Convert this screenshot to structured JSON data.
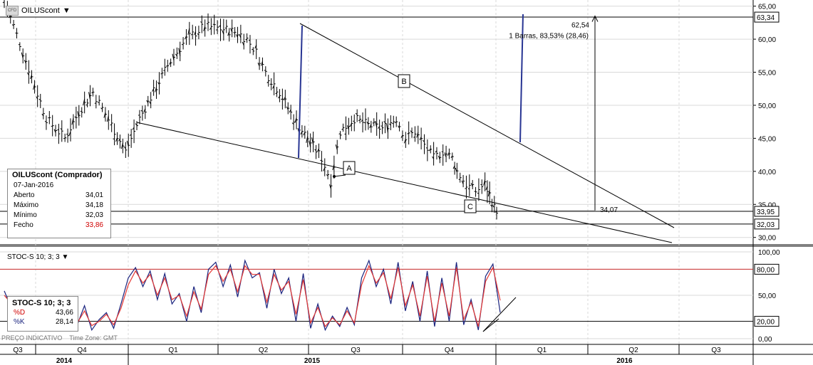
{
  "symbol": {
    "name": "OILUScont",
    "badge": "CFD"
  },
  "info_box": {
    "title": "OILUScont (Comprador)",
    "date": "07-Jan-2016",
    "rows": [
      {
        "label": "Aberto",
        "value": "34,01",
        "highlight": false
      },
      {
        "label": "Máximo",
        "value": "34,18",
        "highlight": false
      },
      {
        "label": "Mínimo",
        "value": "32,03",
        "highlight": false
      },
      {
        "label": "Fecho",
        "value": "33,86",
        "highlight": true
      }
    ]
  },
  "indicator": {
    "label": "STOC-S 10; 3; 3",
    "box_title": "STOC-S 10; 3; 3",
    "d_label": "%D",
    "d_value": "43,66",
    "k_label": "%K",
    "k_value": "28,14"
  },
  "footer": {
    "price_note": "PREÇO INDICATIVO",
    "timezone": "Time Zone: GMT"
  },
  "colors": {
    "k_line": "#1a237e",
    "d_line": "#e53935",
    "price": "#000000",
    "measure_line": "#283593",
    "hline_red": "#c62828",
    "grid": "#d9d9d9"
  },
  "chart_data": [
    {
      "type": "line",
      "subtype": "ohlc-bars",
      "title": "",
      "xlabel": "",
      "ylabel": "",
      "ylim": [
        29,
        65.5
      ],
      "y_ticks": [
        "30,00",
        "35,00",
        "40,00",
        "45,00",
        "50,00",
        "55,00",
        "60,00",
        "65,00"
      ],
      "x_quarters": [
        "Q3",
        "Q4",
        "Q1",
        "Q2",
        "Q3",
        "Q4",
        "Q1",
        "Q2",
        "Q3"
      ],
      "x_years": [
        "2014",
        "2015",
        "2016"
      ],
      "grid": true,
      "price_path": [
        [
          0,
          66
        ],
        [
          4,
          58
        ],
        [
          9,
          48
        ],
        [
          13,
          45
        ],
        [
          16,
          49
        ],
        [
          19,
          52
        ],
        [
          23,
          47
        ],
        [
          26,
          43
        ],
        [
          29,
          48
        ],
        [
          32,
          52
        ],
        [
          35,
          56
        ],
        [
          39,
          60
        ],
        [
          43,
          62
        ],
        [
          47,
          61.5
        ],
        [
          50,
          61
        ],
        [
          52,
          60
        ],
        [
          54,
          58
        ],
        [
          56,
          55
        ],
        [
          59,
          52
        ],
        [
          62,
          48
        ],
        [
          65,
          45
        ],
        [
          68,
          42
        ],
        [
          70,
          38.5
        ],
        [
          72,
          46
        ],
        [
          75,
          48
        ],
        [
          78,
          47
        ],
        [
          81,
          46.5
        ],
        [
          84,
          48
        ],
        [
          86,
          45
        ],
        [
          88,
          46
        ],
        [
          90,
          44
        ],
        [
          92,
          42
        ],
        [
          94,
          43
        ],
        [
          96,
          42
        ],
        [
          97,
          40
        ],
        [
          99,
          38
        ],
        [
          101,
          37
        ],
        [
          103,
          38
        ],
        [
          104,
          36.5
        ],
        [
          105,
          34.5
        ],
        [
          106,
          33.86
        ]
      ],
      "price_labels": [
        "63,34",
        "33,95",
        "32,03"
      ],
      "annotations": [
        {
          "text": "A",
          "y": 38.0
        },
        {
          "text": "B",
          "y": 50.3
        },
        {
          "text": "C",
          "y": 33.3
        }
      ],
      "measure": {
        "start_label": "34,07",
        "end_label": "62,54",
        "info": "1 Barras, 83,53% (28,46)"
      },
      "horizontal_levels": [
        63.34,
        33.95,
        32.03
      ]
    },
    {
      "type": "line",
      "subtype": "stochastic",
      "title": "",
      "xlabel": "",
      "ylabel": "",
      "ylim": [
        0,
        100
      ],
      "y_ticks": [
        "0,00",
        "50,00",
        "100,00"
      ],
      "y_labels": [
        "80,00",
        "20,00"
      ],
      "levels": [
        80,
        20
      ],
      "series": [
        {
          "name": "%K",
          "values": [
            55,
            35,
            48,
            18,
            36,
            20,
            46,
            28,
            42,
            12,
            16,
            38,
            10,
            22,
            30,
            12,
            40,
            70,
            82,
            60,
            78,
            45,
            75,
            40,
            52,
            20,
            60,
            30,
            80,
            88,
            60,
            85,
            48,
            90,
            70,
            76,
            35,
            80,
            52,
            70,
            20,
            75,
            12,
            40,
            10,
            26,
            14,
            36,
            16,
            70,
            90,
            60,
            80,
            40,
            88,
            32,
            66,
            20,
            78,
            14,
            70,
            20,
            88,
            16,
            45,
            10,
            72,
            86,
            30
          ]
        },
        {
          "name": "%D",
          "values": [
            50,
            40,
            42,
            25,
            32,
            24,
            40,
            32,
            38,
            18,
            18,
            32,
            15,
            20,
            28,
            16,
            35,
            62,
            78,
            64,
            74,
            50,
            70,
            45,
            50,
            26,
            54,
            34,
            74,
            84,
            66,
            80,
            54,
            84,
            74,
            74,
            42,
            74,
            56,
            66,
            28,
            68,
            18,
            36,
            14,
            24,
            16,
            32,
            18,
            62,
            84,
            64,
            76,
            46,
            82,
            38,
            62,
            26,
            72,
            20,
            64,
            26,
            82,
            22,
            42,
            14,
            66,
            82,
            44
          ]
        }
      ]
    }
  ]
}
